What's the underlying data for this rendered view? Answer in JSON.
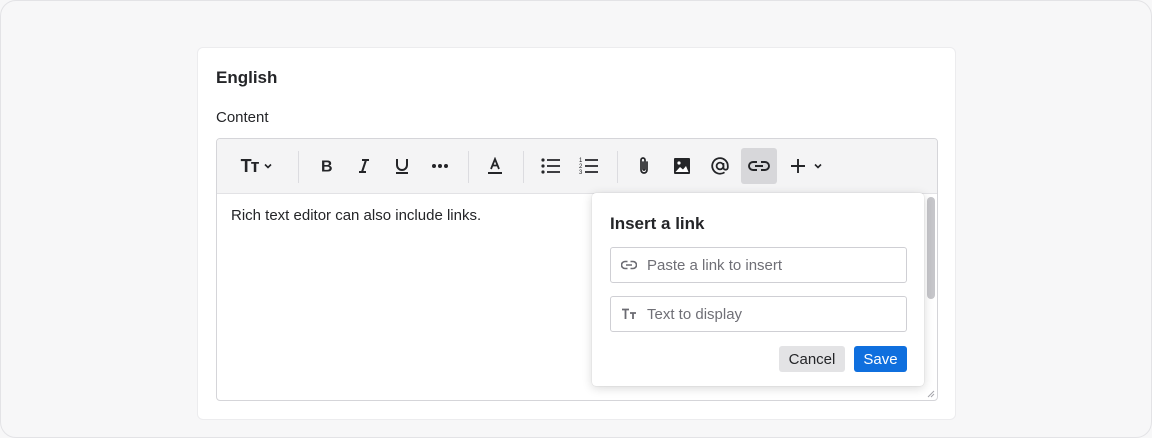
{
  "card": {
    "title": "English",
    "field_label": "Content"
  },
  "toolbar": {
    "text_style_glyph": "Tт",
    "items": [
      {
        "name": "text-style-icon",
        "label": "Text style"
      },
      {
        "name": "bold-icon",
        "label": "Bold"
      },
      {
        "name": "italic-icon",
        "label": "Italic"
      },
      {
        "name": "underline-icon",
        "label": "Underline"
      },
      {
        "name": "more-icon",
        "label": "More formatting"
      },
      {
        "name": "text-color-icon",
        "label": "Text color"
      },
      {
        "name": "bullet-list-icon",
        "label": "Bulleted list"
      },
      {
        "name": "numbered-list-icon",
        "label": "Numbered list"
      },
      {
        "name": "attachment-icon",
        "label": "Attach file"
      },
      {
        "name": "image-icon",
        "label": "Insert image"
      },
      {
        "name": "mention-icon",
        "label": "Mention"
      },
      {
        "name": "link-icon",
        "label": "Insert link",
        "active": true
      },
      {
        "name": "plus-icon",
        "label": "Insert more"
      }
    ]
  },
  "editor": {
    "content": "Rich text editor can also include links."
  },
  "link_popover": {
    "title": "Insert a link",
    "url_placeholder": "Paste a link to insert",
    "url_value": "",
    "text_placeholder": "Text to display",
    "text_value": "",
    "cancel_label": "Cancel",
    "save_label": "Save"
  },
  "colors": {
    "primary": "#0f6fde",
    "active_toolbar_bg": "#d7d7da",
    "toolbar_bg": "#f4f4f5"
  }
}
